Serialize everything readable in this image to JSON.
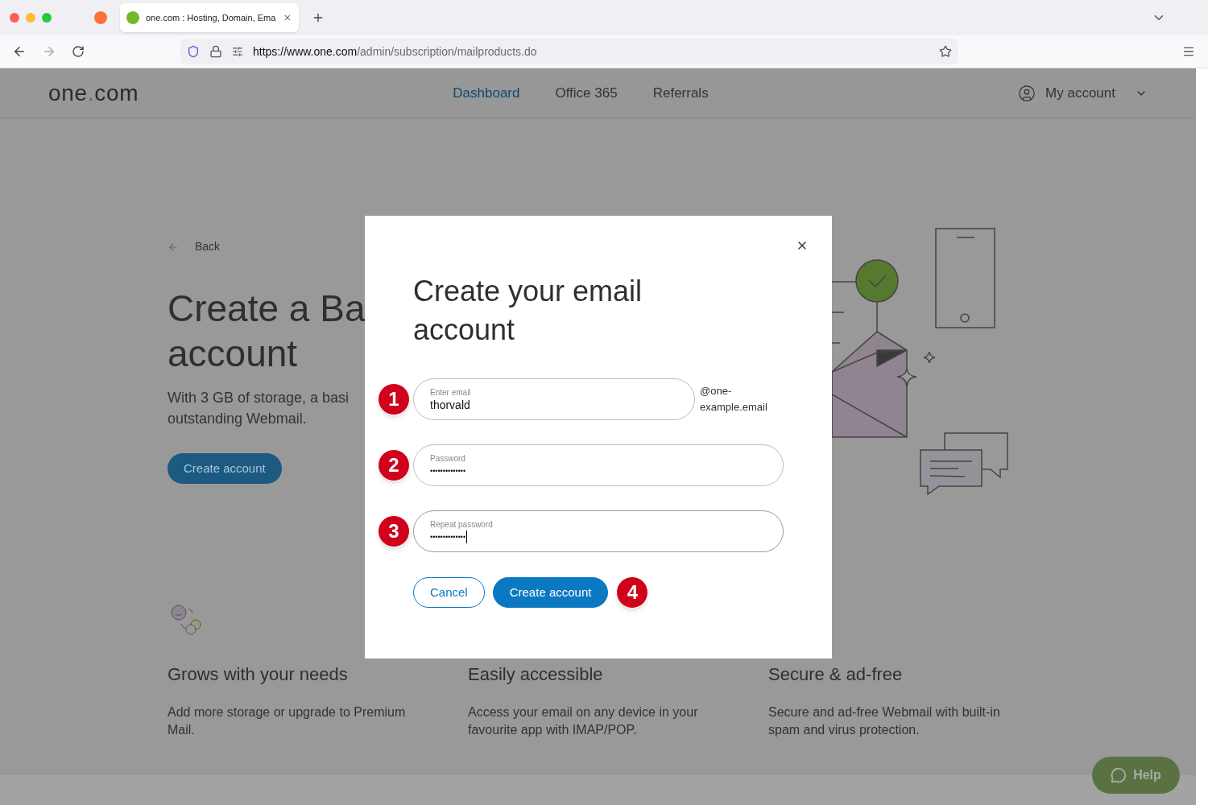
{
  "browser": {
    "tab_title": "one.com : Hosting, Domain, Ema",
    "url_host": "https://www.one.com",
    "url_path": "/admin/subscription/mailproducts.do"
  },
  "header": {
    "logo_parts": [
      "one",
      ".",
      "com"
    ],
    "nav": [
      {
        "label": "Dashboard",
        "selected": true
      },
      {
        "label": "Office 365",
        "selected": false
      },
      {
        "label": "Referrals",
        "selected": false
      }
    ],
    "account": "My account"
  },
  "page": {
    "back": "Back",
    "heading_lines": [
      "Create a Ba",
      "account"
    ],
    "description_lines": [
      "With 3 GB of storage, a basi",
      "outstanding Webmail."
    ],
    "create_button": "Create account"
  },
  "features": [
    {
      "title": "Grows with your needs",
      "text": "Add more storage or upgrade to Premium Mail."
    },
    {
      "title": "Easily accessible",
      "text": "Access your email on any device in your favourite app with IMAP/POP."
    },
    {
      "title": "Secure & ad-free",
      "text": "Secure and ad-free Webmail with built-in spam and virus protection."
    }
  ],
  "help": "Help",
  "modal": {
    "title": "Create your email account",
    "fields": [
      {
        "kind": "text",
        "marker": "1",
        "label": "Enter email",
        "value": "thorvald",
        "focused": false,
        "suffix": "@one-example.email"
      },
      {
        "kind": "password",
        "marker": "2",
        "label": "Password",
        "value": "••••••••••••••",
        "focused": false
      },
      {
        "kind": "password",
        "marker": "3",
        "label": "Repeat password",
        "value": "••••••••••••••",
        "focused": true
      }
    ],
    "buttons": [
      {
        "kind": "secondary",
        "label": "Cancel"
      },
      {
        "kind": "primary",
        "label": "Create account"
      }
    ],
    "button_marker": "4"
  }
}
